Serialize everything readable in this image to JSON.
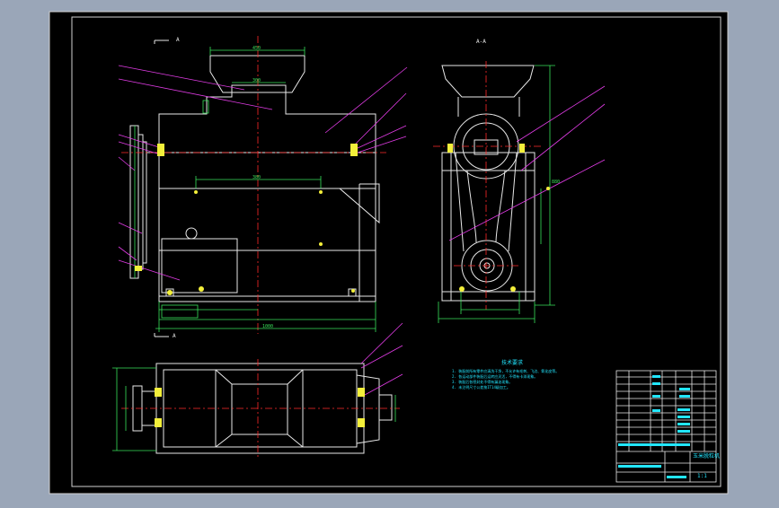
{
  "section_labels": {
    "front": "A",
    "side": "A-A"
  },
  "notes": {
    "heading": "技术要求",
    "lines": [
      "1. 装配前所有零件应清洗干净，不允许有毛刺、飞边、氧化皮等。",
      "2. 各运动部件装配后运转应灵活，不得有卡滞现象。",
      "3. 装配后各密封处不得有漏油现象。",
      "4. 未注明尺寸公差按IT14级加工。"
    ]
  },
  "title_block": {
    "name": "玉米脱粒机",
    "scale": "1:1"
  },
  "dimensions": {
    "top": "450",
    "upper": "300",
    "mid": "380",
    "total": "1000",
    "height": "880"
  },
  "colors": {
    "bg": "#000000",
    "outline": "#ffffff",
    "center": "#ff2020",
    "dim": "#33e05a",
    "leader": "#e23ce6",
    "text": "#22e6ff"
  }
}
